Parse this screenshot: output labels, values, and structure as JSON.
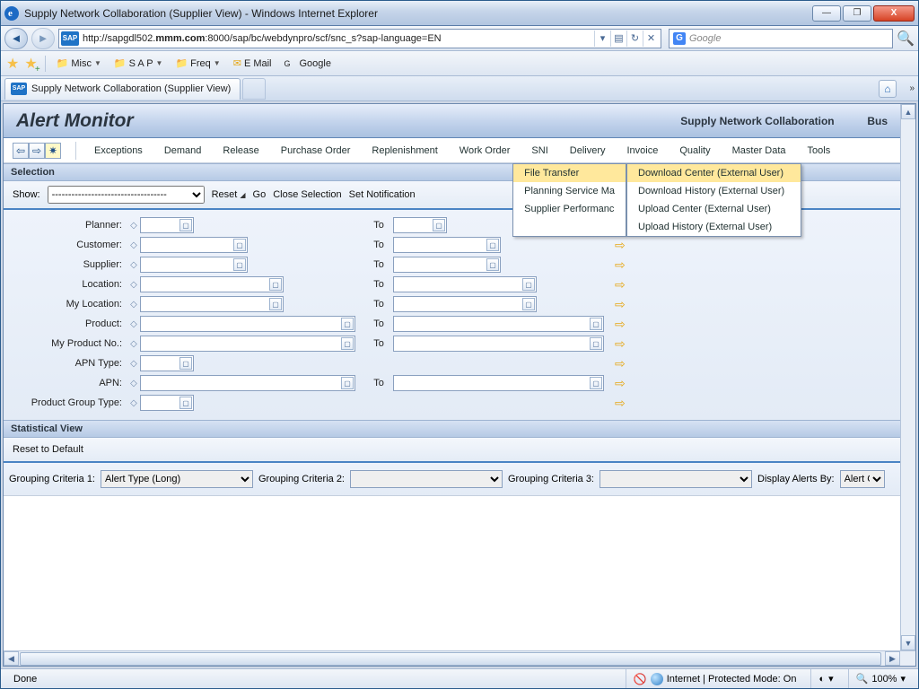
{
  "window": {
    "title": "Supply Network Collaboration (Supplier View) - Windows Internet Explorer",
    "minimize": "—",
    "maximize": "❐",
    "close": "X"
  },
  "nav": {
    "url_prefix": "http://sapgdl502.",
    "url_domain": "mmm.com",
    "url_rest": ":8000/sap/bc/webdynpro/scf/snc_s?sap-language=EN",
    "search_placeholder": "Google"
  },
  "favorites": {
    "items": [
      "Misc",
      "S A P",
      "Freq",
      "E Mail",
      "Google"
    ]
  },
  "tab": {
    "title": "Supply Network Collaboration (Supplier View)"
  },
  "sap": {
    "page_title": "Alert Monitor",
    "brand": "Supply Network Collaboration",
    "brand_cut": "Bus",
    "menu": [
      "Exceptions",
      "Demand",
      "Release",
      "Purchase Order",
      "Replenishment",
      "Work Order",
      "SNI",
      "Delivery",
      "Invoice",
      "Quality",
      "Master Data",
      "Tools"
    ],
    "tools_submenu": [
      "File Transfer",
      "Planning Service Ma",
      "Supplier Performanc"
    ],
    "tools_sub2": [
      "Download Center (External User)",
      "Download History (External User)",
      "Upload Center (External User)",
      "Upload History (External User)"
    ],
    "selection_header": "Selection",
    "show_label": "Show:",
    "show_options": "-----------------------------------",
    "reset": "Reset",
    "go": "Go",
    "close_sel": "Close Selection",
    "set_notif": "Set Notification",
    "fields": {
      "planner": "Planner:",
      "customer": "Customer:",
      "supplier": "Supplier:",
      "location": "Location:",
      "mylocation": "My Location:",
      "product": "Product:",
      "myprod": "My Product No.:",
      "apntype": "APN Type:",
      "apn": "APN:",
      "pgt": "Product Group Type:"
    },
    "to": "To",
    "stat_header": "Statistical View",
    "reset_default": "Reset to Default",
    "gc1": "Grouping Criteria 1:",
    "gc2": "Grouping Criteria 2:",
    "gc3": "Grouping Criteria 3:",
    "gc1_val": "Alert Type (Long)",
    "display_by": "Display Alerts By:",
    "display_val": "Alert Cat"
  },
  "status": {
    "done": "Done",
    "mode": "Internet | Protected Mode: On",
    "zoom": "100%"
  }
}
